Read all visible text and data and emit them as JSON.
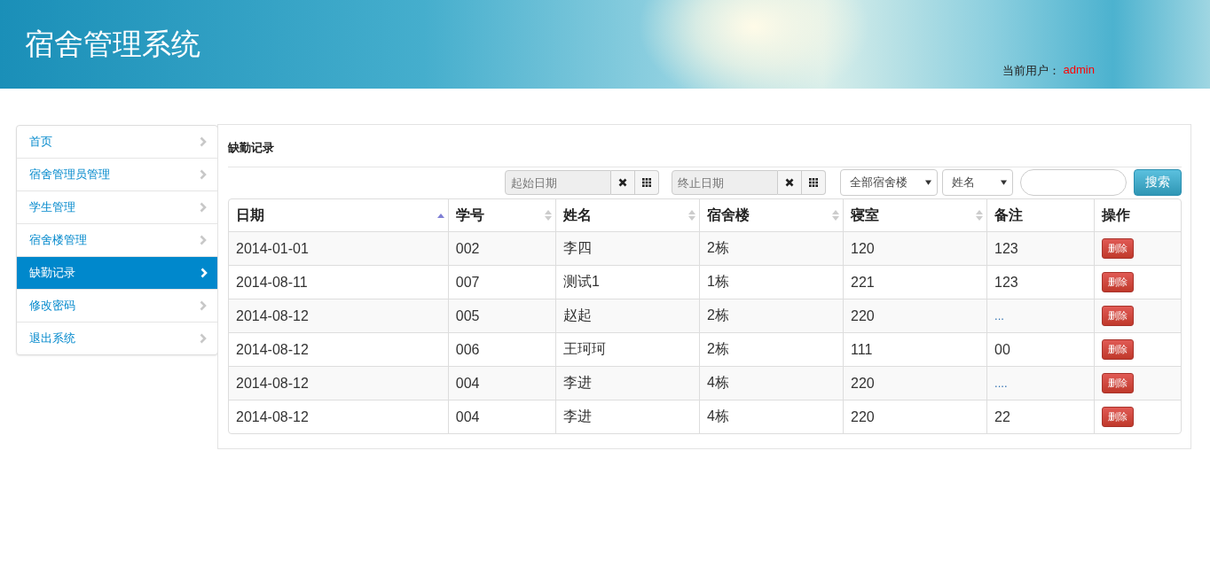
{
  "header": {
    "title": "宿舍管理系统",
    "user_label": "当前用户：",
    "user_name": "admin"
  },
  "sidebar": {
    "items": [
      {
        "label": "首页",
        "selected": false
      },
      {
        "label": "宿舍管理员管理",
        "selected": false
      },
      {
        "label": "学生管理",
        "selected": false
      },
      {
        "label": "宿舍楼管理",
        "selected": false
      },
      {
        "label": "缺勤记录",
        "selected": true
      },
      {
        "label": "修改密码",
        "selected": false
      },
      {
        "label": "退出系统",
        "selected": false
      }
    ]
  },
  "panel": {
    "title": "缺勤记录",
    "filters": {
      "start_date": {
        "placeholder": "起始日期"
      },
      "end_date": {
        "placeholder": "终止日期"
      },
      "building_select": "全部宿舍楼",
      "field_select": "姓名",
      "search_button": "搜索"
    },
    "table": {
      "columns": [
        {
          "label": "日期",
          "sortable": true,
          "sorted_ascending": true
        },
        {
          "label": "学号",
          "sortable": true,
          "sorted_ascending": false
        },
        {
          "label": "姓名",
          "sortable": true,
          "sorted_ascending": false
        },
        {
          "label": "宿舍楼",
          "sortable": true,
          "sorted_ascending": false
        },
        {
          "label": "寝室",
          "sortable": true,
          "sorted_ascending": false
        },
        {
          "label": "备注",
          "sortable": false
        },
        {
          "label": "操作",
          "sortable": false
        }
      ],
      "rows": [
        {
          "cells": [
            "2014-01-01",
            "002",
            "李四",
            "2栋",
            "120",
            "123"
          ],
          "action": "删除"
        },
        {
          "cells": [
            "2014-08-11",
            "007",
            "测试1",
            "1栋",
            "221",
            "123"
          ],
          "action": "删除"
        },
        {
          "cells": [
            "2014-08-12",
            "005",
            "赵起",
            "2栋",
            "220",
            "..."
          ],
          "action": "删除"
        },
        {
          "cells": [
            "2014-08-12",
            "006",
            "王珂珂",
            "2栋",
            "111",
            "00"
          ],
          "action": "删除"
        },
        {
          "cells": [
            "2014-08-12",
            "004",
            "李进",
            "4栋",
            "220",
            "...."
          ],
          "action": "删除"
        },
        {
          "cells": [
            "2014-08-12",
            "004",
            "李进",
            "4栋",
            "220",
            "22"
          ],
          "action": "删除"
        }
      ]
    }
  }
}
